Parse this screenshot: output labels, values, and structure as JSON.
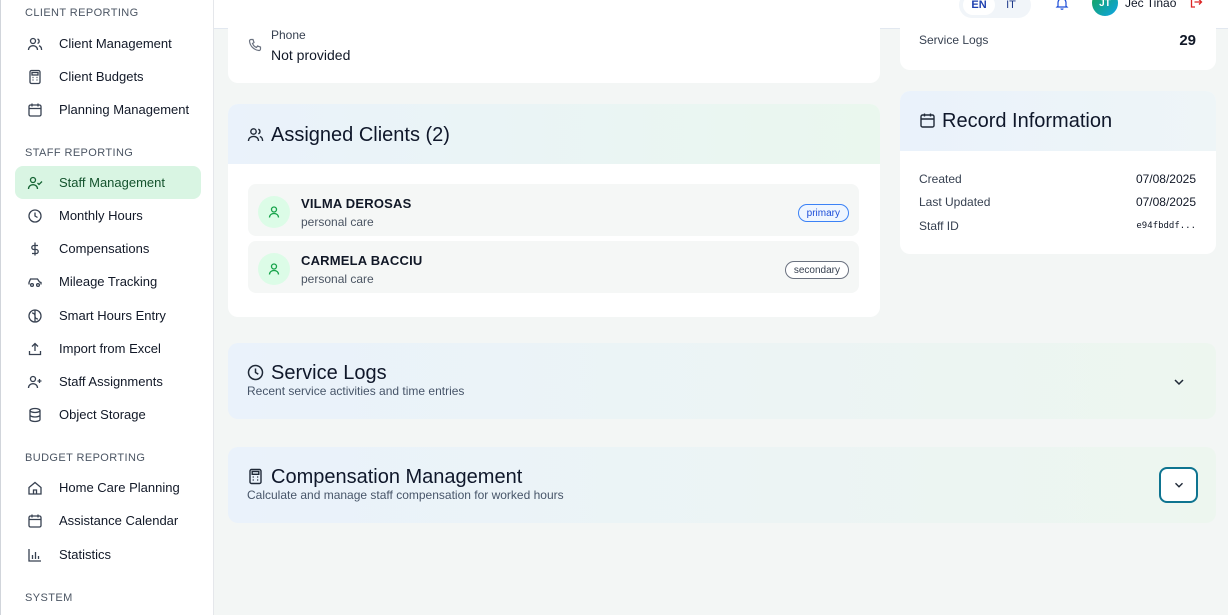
{
  "sidebar": {
    "client_reporting": {
      "title": "CLIENT REPORTING",
      "items": [
        {
          "label": "Client Management",
          "icon": "users-icon"
        },
        {
          "label": "Client Budgets",
          "icon": "calculator-icon"
        },
        {
          "label": "Planning Management",
          "icon": "calendar-icon"
        }
      ]
    },
    "staff_reporting": {
      "title": "STAFF REPORTING",
      "items": [
        {
          "label": "Staff Management",
          "icon": "user-check-icon",
          "active": true
        },
        {
          "label": "Monthly Hours",
          "icon": "clock-icon"
        },
        {
          "label": "Compensations",
          "icon": "dollar-icon"
        },
        {
          "label": "Mileage Tracking",
          "icon": "car-icon"
        },
        {
          "label": "Smart Hours Entry",
          "icon": "brain-icon"
        },
        {
          "label": "Import from Excel",
          "icon": "upload-icon"
        },
        {
          "label": "Staff Assignments",
          "icon": "user-plus-icon"
        },
        {
          "label": "Object Storage",
          "icon": "database-icon"
        }
      ]
    },
    "budget_reporting": {
      "title": "BUDGET REPORTING",
      "items": [
        {
          "label": "Home Care Planning",
          "icon": "home-icon"
        },
        {
          "label": "Assistance Calendar",
          "icon": "calendar-icon"
        },
        {
          "label": "Statistics",
          "icon": "bar-chart-icon"
        }
      ]
    },
    "system": {
      "title": "SYSTEM"
    }
  },
  "header": {
    "languages": [
      "EN",
      "IT"
    ],
    "active_language": "EN",
    "user_initials": "JT",
    "user_name": "Jec Tinao"
  },
  "contact": {
    "phone_label": "Phone",
    "phone_value": "Not provided"
  },
  "stats": {
    "service_logs_label": "Service Logs",
    "service_logs_value": "29"
  },
  "assigned_clients": {
    "title": "Assigned Clients (2)",
    "clients": [
      {
        "name": "VILMA DEROSAS",
        "type": "personal care",
        "badge": "primary"
      },
      {
        "name": "CARMELA BACCIU",
        "type": "personal care",
        "badge": "secondary"
      }
    ]
  },
  "record_information": {
    "title": "Record Information",
    "created_label": "Created",
    "created_value": "07/08/2025",
    "updated_label": "Last Updated",
    "updated_value": "07/08/2025",
    "staff_id_label": "Staff ID",
    "staff_id_value": "e94fbddf..."
  },
  "service_logs_section": {
    "title": "Service Logs",
    "subtitle": "Recent service activities and time entries"
  },
  "compensation_section": {
    "title": "Compensation Management",
    "subtitle": "Calculate and manage staff compensation for worked hours"
  },
  "colors": {
    "accent_active_bg": "#d9f5e3",
    "primary_badge": "#3b82f6",
    "focus_ring": "#0e7490"
  }
}
